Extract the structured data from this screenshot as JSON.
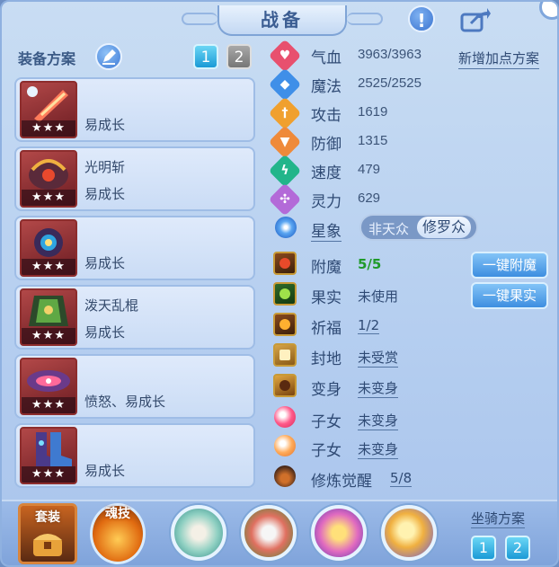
{
  "header": {
    "title": "战备"
  },
  "equipment_panel": {
    "plan_label": "装备方案",
    "plan_tabs": [
      "1",
      "2"
    ],
    "items": [
      {
        "name": "",
        "attr": "易成长",
        "stars": "★★★"
      },
      {
        "name": "光明斩",
        "attr": "易成长",
        "stars": "★★★"
      },
      {
        "name": "",
        "attr": "易成长",
        "stars": "★★★"
      },
      {
        "name": "泼天乱棍",
        "attr": "易成长",
        "stars": "★★★"
      },
      {
        "name": "",
        "attr": "愤怒、易成长",
        "stars": "★★★"
      },
      {
        "name": "",
        "attr": "易成长",
        "stars": "★★★"
      }
    ]
  },
  "stats": {
    "add_plan_label": "新增加点方案",
    "rows": [
      {
        "icon": "heart-icon",
        "label": "气血",
        "value": "3963/3963",
        "color": "#e8506e"
      },
      {
        "icon": "diamond-icon",
        "label": "魔法",
        "value": "2525/2525",
        "color": "#3f8fe8"
      },
      {
        "icon": "sword-icon",
        "label": "攻击",
        "value": "1619",
        "color": "#f0a02e"
      },
      {
        "icon": "shield-icon",
        "label": "防御",
        "value": "1315",
        "color": "#ef8a3a"
      },
      {
        "icon": "speed-icon",
        "label": "速度",
        "value": "479",
        "color": "#22b58a"
      },
      {
        "icon": "spirit-icon",
        "label": "灵力",
        "value": "629",
        "color": "#b36ad8"
      }
    ],
    "constellation": {
      "label": "星象",
      "options": [
        "非天众",
        "修罗众"
      ],
      "selected": "修罗众"
    }
  },
  "enhancements": {
    "rows": [
      {
        "icon": "enchant-icon",
        "label": "附魔",
        "value": "5/5"
      },
      {
        "icon": "fruit-icon",
        "label": "果实",
        "value": "未使用"
      },
      {
        "icon": "blessing-icon",
        "label": "祈福",
        "value": "1/2"
      },
      {
        "icon": "territory-icon",
        "label": "封地",
        "value": "未受赏"
      },
      {
        "icon": "transform-icon",
        "label": "变身",
        "value": "未变身"
      },
      {
        "icon": "child-icon",
        "label": "子女",
        "value": "未变身"
      },
      {
        "icon": "child-icon-2",
        "label": "子女",
        "value": "未变身"
      },
      {
        "icon": "awaken-icon",
        "label": "修炼觉醒",
        "value": "5/8"
      }
    ],
    "one_click_enchant": "一键附魔",
    "one_click_fruit": "一键果实"
  },
  "bottom": {
    "suit_label": "套装",
    "soul_skill_label": "魂技",
    "mount_plan_label": "坐骑方案",
    "mount_tabs": [
      "1",
      "2"
    ]
  }
}
